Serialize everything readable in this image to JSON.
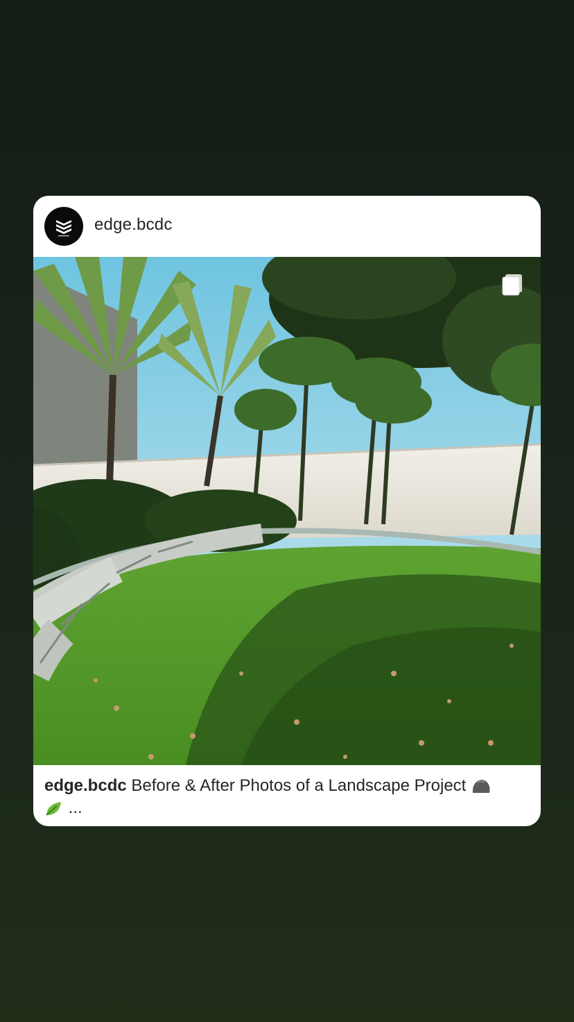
{
  "post": {
    "username": "edge.bcdc",
    "caption_user": "edge.bcdc",
    "caption_text": "Before & After Photos of a Landscape Project",
    "caption_more": "...",
    "caption_emojis": [
      "rock-emoji",
      "leaf-emoji"
    ],
    "media_type_icon": "carousel-icon"
  },
  "colors": {
    "background": "#18231a",
    "card": "#ffffff",
    "text": "#262626",
    "avatar": "#0b0b0b"
  }
}
